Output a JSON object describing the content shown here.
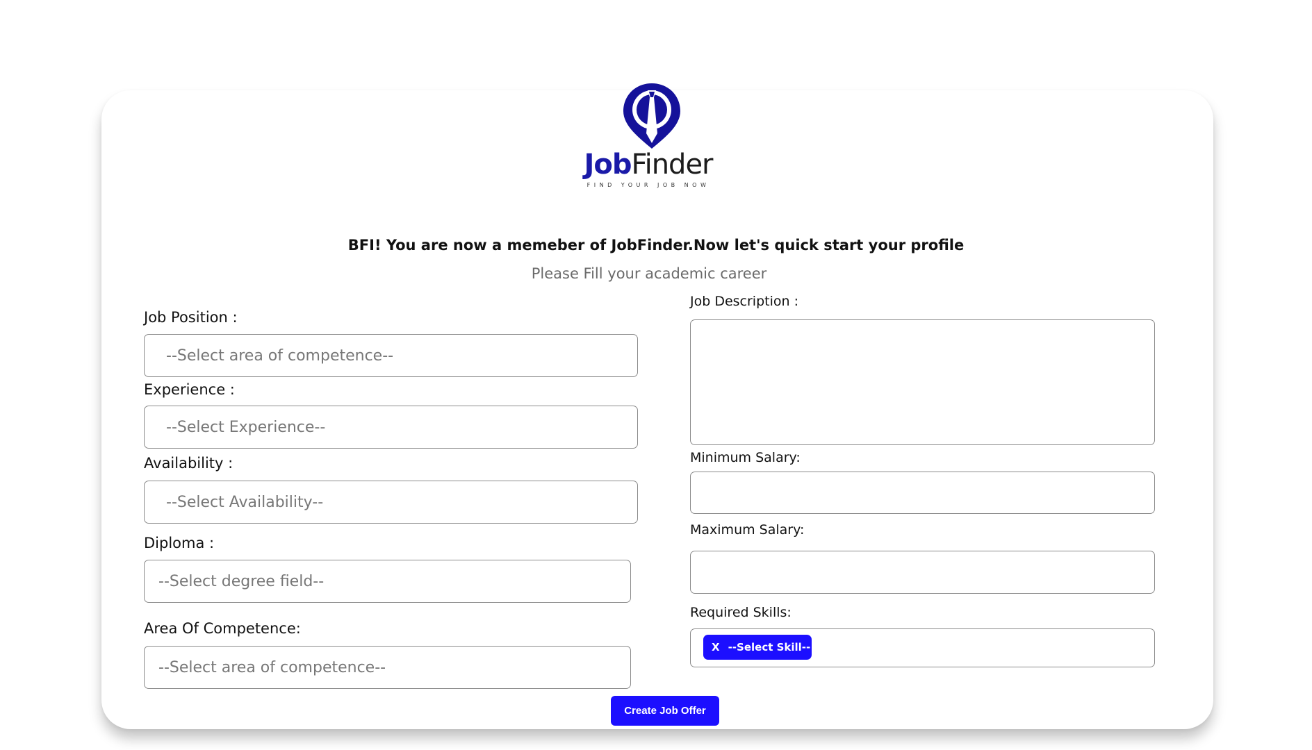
{
  "brand": {
    "name_part1": "Job",
    "name_part2": "Finder",
    "tagline": "FIND YOUR JOB NOW",
    "logo_icon": "map-pin-tie-icon",
    "primary_color": "#1a1aa8",
    "accent_color": "#1c0fff"
  },
  "header": {
    "headline": "BFI! You are now a memeber of JobFinder.Now let's quick start your profile",
    "subheadline": "Please Fill your academic career"
  },
  "left_form": {
    "job_position": {
      "label": "Job Position :",
      "value": "--Select area of competence--"
    },
    "experience": {
      "label": "Experience :",
      "value": "--Select Experience--"
    },
    "availability": {
      "label": "Availability :",
      "value": "--Select Availability--"
    },
    "diploma": {
      "label": "Diploma :",
      "value": "--Select degree field--"
    },
    "area_of_competence": {
      "label": "Area Of Competence:",
      "value": "--Select area of competence--"
    }
  },
  "right_form": {
    "job_description": {
      "label": "Job Description :",
      "value": ""
    },
    "minimum_salary": {
      "label": "Minimum Salary:",
      "value": ""
    },
    "maximum_salary": {
      "label": "Maximum Salary:",
      "value": ""
    },
    "required_skills": {
      "label": "Required Skills:",
      "chip_remove": "X",
      "chip_label": "--Select Skill--"
    }
  },
  "actions": {
    "submit_label": "Create Job Offer"
  }
}
